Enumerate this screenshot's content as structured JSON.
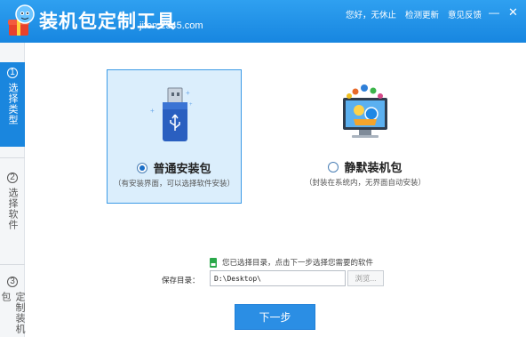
{
  "titlebar": {
    "title": "装机包定制工具",
    "domain": "jifen.2345.com",
    "greeting": "您好，无休止",
    "links": [
      "检测更新",
      "意见反馈"
    ],
    "minimize_glyph": "—",
    "close_glyph": "✕",
    "bg_color": "#1a8ae2"
  },
  "sidebar": {
    "steps": [
      {
        "num": "1",
        "label": "选择类型",
        "active": true
      },
      {
        "num": "2",
        "label": "选择软件",
        "active": false
      },
      {
        "num": "3",
        "label": "定制装机包",
        "active": false
      }
    ]
  },
  "options": {
    "normal": {
      "title": "普通安装包",
      "desc": "（有安装界面，可以选择软件安装）",
      "selected": true,
      "icon": "usb-drive-icon"
    },
    "silent": {
      "title": "静默装机包",
      "desc": "（封装在系统内，无界面自动安装）",
      "selected": false,
      "icon": "monitor-apps-icon"
    }
  },
  "hint": {
    "text": "您已选择目录，点击下一步选择您需要的软件",
    "icon": "green-folder-icon"
  },
  "save": {
    "label": "保存目录：",
    "value": "D:\\Desktop\\",
    "browse_label": "浏览..."
  },
  "next_label": "下一步",
  "colors": {
    "accent": "#1a86de",
    "selected_bg": "#dbeefc",
    "selected_border": "#3d9be6"
  }
}
